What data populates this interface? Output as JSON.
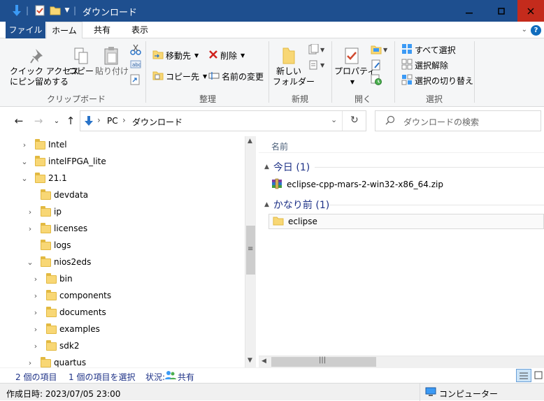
{
  "window": {
    "title": "ダウンロード",
    "colors": {
      "titlebar": "#1e4f8f",
      "close": "#c42b1c",
      "accent": "#0f6cbd"
    }
  },
  "tabs": {
    "file": "ファイル",
    "home": "ホーム",
    "share": "共有",
    "view": "表示"
  },
  "ribbon": {
    "clipboard": {
      "label": "クリップボード",
      "pin_line1": "クイック アクセス",
      "pin_line2": "にピン留めする",
      "copy": "コピー",
      "paste": "貼り付け"
    },
    "organize": {
      "label": "整理",
      "move_to": "移動先",
      "copy_to": "コピー先",
      "delete": "削除",
      "rename": "名前の変更"
    },
    "new": {
      "label": "新規",
      "new_folder_line1": "新しい",
      "new_folder_line2": "フォルダー"
    },
    "open": {
      "label": "開く",
      "properties": "プロパティ"
    },
    "select": {
      "label": "選択",
      "select_all": "すべて選択",
      "select_none": "選択解除",
      "invert": "選択の切り替え"
    }
  },
  "address": {
    "root": "PC",
    "current": "ダウンロード"
  },
  "search": {
    "placeholder": "ダウンロードの検索"
  },
  "tree": [
    {
      "label": "Intel",
      "chev": "›",
      "indent": 0
    },
    {
      "label": "intelFPGA_lite",
      "chev": "⌄",
      "indent": 0
    },
    {
      "label": "21.1",
      "chev": "⌄",
      "indent": 1
    },
    {
      "label": "devdata",
      "chev": "",
      "indent": 2
    },
    {
      "label": "ip",
      "chev": "›",
      "indent": 2
    },
    {
      "label": "licenses",
      "chev": "›",
      "indent": 2
    },
    {
      "label": "logs",
      "chev": "",
      "indent": 2
    },
    {
      "label": "nios2eds",
      "chev": "⌄",
      "indent": 2
    },
    {
      "label": "bin",
      "chev": "›",
      "indent": 3
    },
    {
      "label": "components",
      "chev": "›",
      "indent": 3
    },
    {
      "label": "documents",
      "chev": "›",
      "indent": 3
    },
    {
      "label": "examples",
      "chev": "›",
      "indent": 3
    },
    {
      "label": "sdk2",
      "chev": "›",
      "indent": 3
    },
    {
      "label": "quartus",
      "chev": "›",
      "indent": 2
    }
  ],
  "content": {
    "column_name": "名前",
    "groups": [
      {
        "title": "今日 (1)",
        "items": [
          {
            "name": "eclipse-cpp-mars-2-win32-x86_64.zip",
            "type": "zip"
          }
        ]
      },
      {
        "title": "かなり前 (1)",
        "items": [
          {
            "name": "eclipse",
            "type": "folder"
          }
        ]
      }
    ]
  },
  "status": {
    "count": "2 個の項目",
    "selected": "1 個の項目を選択",
    "state_label": "状況:",
    "state_value": "共有"
  },
  "details": {
    "created": "作成日時: 2023/07/05 23:00",
    "computer": "コンピューター"
  }
}
